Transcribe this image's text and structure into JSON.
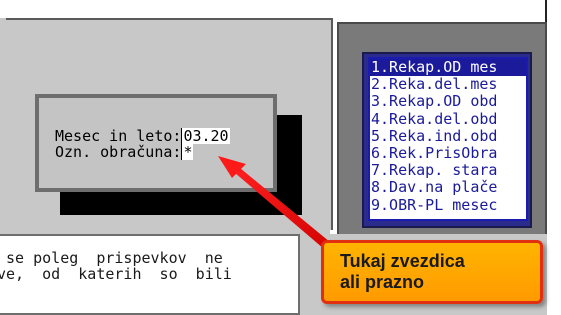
{
  "dialog": {
    "month_year_label": "Mesec in leto:",
    "month_year_value": "03.20",
    "calc_label": "Ozn. obračuna:",
    "calc_value": "*"
  },
  "menu": {
    "items": [
      {
        "label": "1.Rekap.OD mes",
        "selected": true
      },
      {
        "label": "2.Reka.del.mes",
        "selected": false
      },
      {
        "label": "3.Rekap.OD obd",
        "selected": false
      },
      {
        "label": "4.Reka.del.obd",
        "selected": false
      },
      {
        "label": "5.Reka.ind.obd",
        "selected": false
      },
      {
        "label": "6.Rek.PrisObra",
        "selected": false
      },
      {
        "label": "7.Rekap. stara",
        "selected": false
      },
      {
        "label": "8.Dav.na plače",
        "selected": false
      },
      {
        "label": "9.OBR-PL mesec",
        "selected": false
      }
    ]
  },
  "info_text": {
    "line1": " se poleg  prispevkov  ne",
    "line2": "ve,  od  katerih  so  bili"
  },
  "callout": {
    "line1": "Tukaj zvezdica",
    "line2": "ali prazno"
  },
  "colors": {
    "menu_selected_bg": "#1a1a9a",
    "menu_text": "#1a1a9a",
    "callout_bg": "#ffa800",
    "callout_border": "#e03010",
    "arrow": "#ff1010"
  }
}
